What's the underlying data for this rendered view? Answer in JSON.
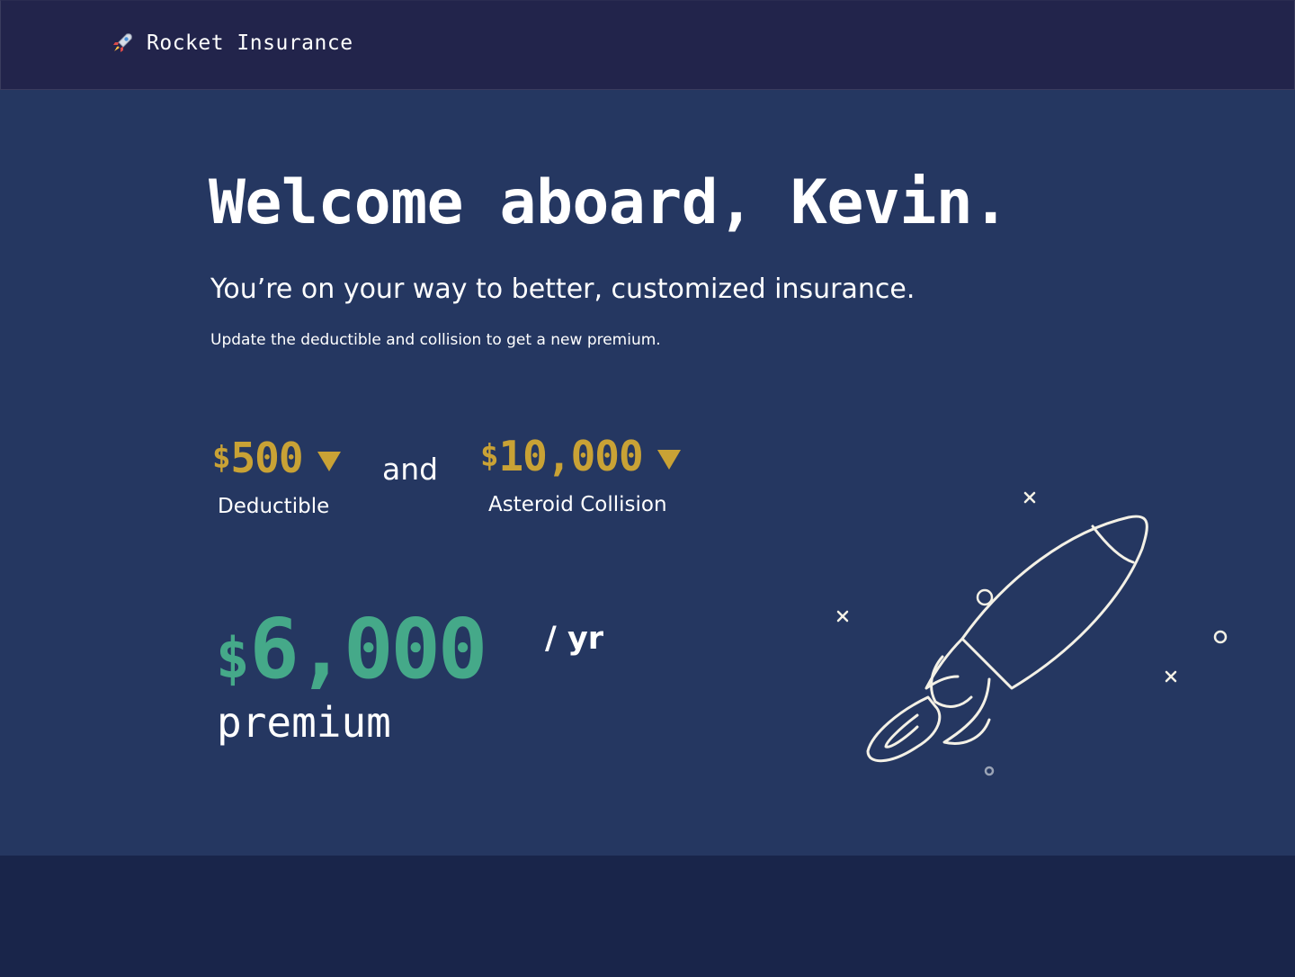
{
  "nav": {
    "brand_icon": "rocket-icon",
    "brand_name": "Rocket Insurance"
  },
  "hero": {
    "headline": "Welcome aboard, Kevin.",
    "subheadline": "You’re on your way to better, customized insurance.",
    "instructions": "Update the deductible and collision to get a new premium."
  },
  "quote": {
    "deductible": {
      "currency": "$",
      "amount": "500",
      "label": "Deductible",
      "caret_icon": "caret-down-icon"
    },
    "conjunction": "and",
    "collision": {
      "currency": "$",
      "amount": "10,000",
      "label": "Asteroid Collision",
      "caret_icon": "caret-down-icon"
    },
    "premium": {
      "currency": "$",
      "amount": "6,000",
      "period": "/ yr",
      "label": "premium"
    }
  },
  "illustration": {
    "icon": "rocket-illustration",
    "decorations": [
      "star-icon",
      "planet-icon"
    ]
  },
  "colors": {
    "nav_bg": "#22244b",
    "hero_bg": "#253761",
    "footer_bg": "#19254a",
    "accent_gold": "#c9a235",
    "accent_green": "#45a989",
    "text": "#ffffff"
  }
}
